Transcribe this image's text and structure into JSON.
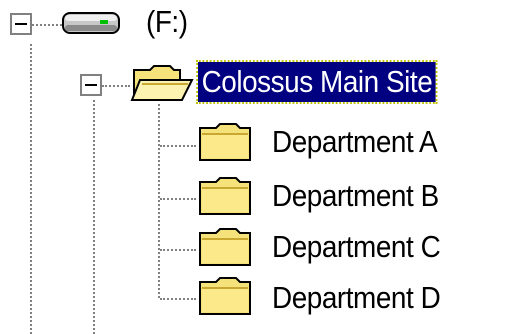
{
  "tree": {
    "drive": {
      "label": "(F:)",
      "expanded": true,
      "icon": "drive-icon"
    },
    "site": {
      "label": "Colossus Main Site",
      "expanded": true,
      "selected": true,
      "icon": "folder-open-icon"
    },
    "departments": [
      {
        "label": "Department A",
        "icon": "folder-icon"
      },
      {
        "label": "Department B",
        "icon": "folder-icon"
      },
      {
        "label": "Department C",
        "icon": "folder-icon"
      },
      {
        "label": "Department D",
        "icon": "folder-icon"
      }
    ]
  },
  "colors": {
    "selection": "#000080",
    "folder": "#f5e27a",
    "connector": "#808080"
  }
}
